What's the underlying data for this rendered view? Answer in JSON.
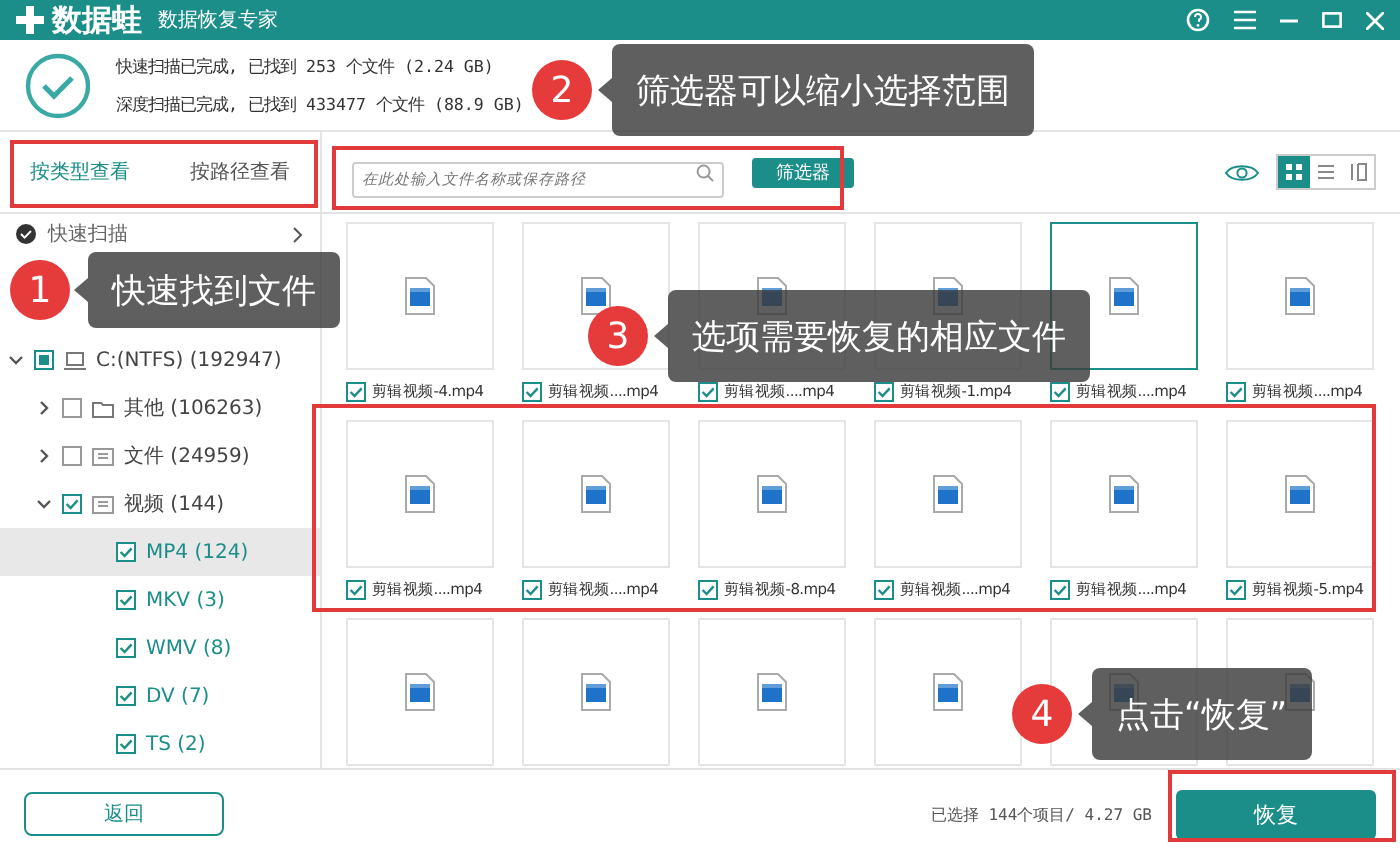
{
  "window": {
    "app_name": "数据蛙",
    "subtitle": "数据恢复专家"
  },
  "scan_summary": [
    "快速扫描已完成, 已找到 253 个文件 (2.24 GB)",
    "深度扫描已完成, 已找到 433477 个文件 (88.9 GB)"
  ],
  "view_tabs": [
    {
      "label": "按类型查看",
      "selected": true
    },
    {
      "label": "按路径查看",
      "selected": false
    }
  ],
  "search": {
    "placeholder": "在此处输入文件名称或保存路径"
  },
  "filter_button": "筛选器",
  "view_modes": [
    {
      "kind": "grid",
      "selected": true
    },
    {
      "kind": "list",
      "selected": false
    },
    {
      "kind": "columns",
      "selected": false
    }
  ],
  "scan_list": [
    {
      "label": "快速扫描"
    }
  ],
  "tree": [
    {
      "label": "C:(NTFS) (192947)",
      "kind": "drive",
      "checked": false,
      "partial": true,
      "expanded": true,
      "selected": false,
      "children": [
        {
          "label": "其他 (106263)",
          "kind": "folder",
          "checked": false,
          "expanded": false,
          "selected": false
        },
        {
          "label": "文件 (24959)",
          "kind": "doc",
          "checked": false,
          "expanded": false,
          "selected": false
        },
        {
          "label": "视频 (144)",
          "kind": "video",
          "checked": true,
          "expanded": true,
          "selected": false,
          "children": [
            {
              "label": "MP4 (124)",
              "kind": "type",
              "checked": true,
              "selected": true
            },
            {
              "label": "MKV (3)",
              "kind": "type",
              "checked": true,
              "selected": false
            },
            {
              "label": "WMV (8)",
              "kind": "type",
              "checked": true,
              "selected": false
            },
            {
              "label": "DV (7)",
              "kind": "type",
              "checked": true,
              "selected": false
            },
            {
              "label": "TS (2)",
              "kind": "type",
              "checked": true,
              "selected": false
            }
          ]
        }
      ]
    }
  ],
  "thumbnail_rows": [
    {
      "files": [
        {
          "kind": "file",
          "label": "剪辑视频-4.mp4",
          "checked": true,
          "selected": false
        },
        {
          "kind": "file",
          "label": "剪辑视频....mp4",
          "checked": true,
          "selected": false
        },
        {
          "kind": "file",
          "label": "剪辑视频....mp4",
          "checked": true,
          "selected": false
        },
        {
          "kind": "file",
          "label": "剪辑视频-1.mp4",
          "checked": true,
          "selected": false
        },
        {
          "kind": "file",
          "label": "剪辑视频....mp4",
          "checked": true,
          "selected": true
        },
        {
          "kind": "file",
          "label": "剪辑视频....mp4",
          "checked": true,
          "selected": false
        }
      ]
    },
    {
      "files": [
        {
          "kind": "file",
          "label": "剪辑视频....mp4",
          "checked": true,
          "selected": false
        },
        {
          "kind": "file",
          "label": "剪辑视频....mp4",
          "checked": true,
          "selected": false
        },
        {
          "kind": "file",
          "label": "剪辑视频-8.mp4",
          "checked": true,
          "selected": false
        },
        {
          "kind": "file",
          "label": "剪辑视频....mp4",
          "checked": true,
          "selected": false
        },
        {
          "kind": "file",
          "label": "剪辑视频....mp4",
          "checked": true,
          "selected": false
        },
        {
          "kind": "file",
          "label": "剪辑视频-5.mp4",
          "checked": true,
          "selected": false
        }
      ]
    },
    {
      "files": [
        {
          "kind": "thumbnail"
        },
        {
          "kind": "thumbnail"
        },
        {
          "kind": "thumbnail"
        },
        {
          "kind": "thumbnail"
        },
        {
          "kind": "thumbnail"
        },
        {
          "kind": "thumbnail"
        }
      ]
    }
  ],
  "footer": {
    "back_button": "返回",
    "status": "已选择 144个项目/ 4.27 GB",
    "recover_button": "恢复"
  },
  "callouts": [
    {
      "number": "1",
      "text": "快速找到文件"
    },
    {
      "number": "2",
      "text": "筛选器可以缩小选择范围"
    },
    {
      "number": "3",
      "text": "选项需要恢复的相应文件"
    },
    {
      "number": "4",
      "text": "点击“恢复”"
    }
  ]
}
